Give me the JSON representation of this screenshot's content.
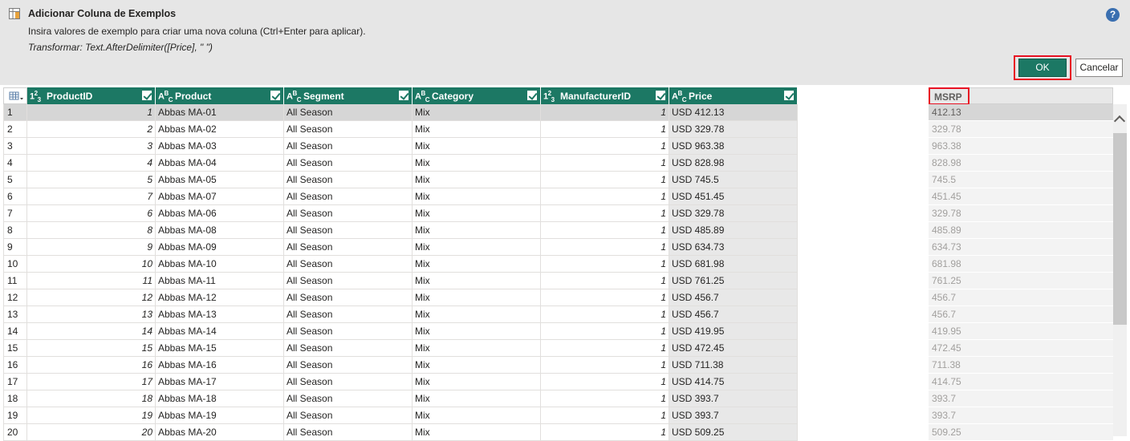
{
  "dialog": {
    "title": "Adicionar Coluna de Exemplos",
    "subtitle": "Insira valores de exemplo para criar uma nova coluna (Ctrl+Enter para aplicar).",
    "transform": "Transformar: Text.AfterDelimiter([Price], \" \")",
    "ok_label": "OK",
    "cancel_label": "Cancelar",
    "help_label": "?"
  },
  "accent_color": "#1c7864",
  "highlight_color": "#e81123",
  "columns": [
    {
      "type": "123",
      "name": "ProductID"
    },
    {
      "type": "ABC",
      "name": "Product"
    },
    {
      "type": "ABC",
      "name": "Segment"
    },
    {
      "type": "ABC",
      "name": "Category"
    },
    {
      "type": "123",
      "name": "ManufacturerID"
    },
    {
      "type": "ABC",
      "name": "Price"
    }
  ],
  "new_column": {
    "name": "MSRP"
  },
  "rows": [
    {
      "n": "1",
      "id": "1",
      "product": "Abbas MA-01",
      "segment": "All Season",
      "category": "Mix",
      "mfr": "1",
      "price": "USD 412.13",
      "msrp": "412.13"
    },
    {
      "n": "2",
      "id": "2",
      "product": "Abbas MA-02",
      "segment": "All Season",
      "category": "Mix",
      "mfr": "1",
      "price": "USD 329.78",
      "msrp": "329.78"
    },
    {
      "n": "3",
      "id": "3",
      "product": "Abbas MA-03",
      "segment": "All Season",
      "category": "Mix",
      "mfr": "1",
      "price": "USD 963.38",
      "msrp": "963.38"
    },
    {
      "n": "4",
      "id": "4",
      "product": "Abbas MA-04",
      "segment": "All Season",
      "category": "Mix",
      "mfr": "1",
      "price": "USD 828.98",
      "msrp": "828.98"
    },
    {
      "n": "5",
      "id": "5",
      "product": "Abbas MA-05",
      "segment": "All Season",
      "category": "Mix",
      "mfr": "1",
      "price": "USD 745.5",
      "msrp": "745.5"
    },
    {
      "n": "6",
      "id": "7",
      "product": "Abbas MA-07",
      "segment": "All Season",
      "category": "Mix",
      "mfr": "1",
      "price": "USD 451.45",
      "msrp": "451.45"
    },
    {
      "n": "7",
      "id": "6",
      "product": "Abbas MA-06",
      "segment": "All Season",
      "category": "Mix",
      "mfr": "1",
      "price": "USD 329.78",
      "msrp": "329.78"
    },
    {
      "n": "8",
      "id": "8",
      "product": "Abbas MA-08",
      "segment": "All Season",
      "category": "Mix",
      "mfr": "1",
      "price": "USD 485.89",
      "msrp": "485.89"
    },
    {
      "n": "9",
      "id": "9",
      "product": "Abbas MA-09",
      "segment": "All Season",
      "category": "Mix",
      "mfr": "1",
      "price": "USD 634.73",
      "msrp": "634.73"
    },
    {
      "n": "10",
      "id": "10",
      "product": "Abbas MA-10",
      "segment": "All Season",
      "category": "Mix",
      "mfr": "1",
      "price": "USD 681.98",
      "msrp": "681.98"
    },
    {
      "n": "11",
      "id": "11",
      "product": "Abbas MA-11",
      "segment": "All Season",
      "category": "Mix",
      "mfr": "1",
      "price": "USD 761.25",
      "msrp": "761.25"
    },
    {
      "n": "12",
      "id": "12",
      "product": "Abbas MA-12",
      "segment": "All Season",
      "category": "Mix",
      "mfr": "1",
      "price": "USD 456.7",
      "msrp": "456.7"
    },
    {
      "n": "13",
      "id": "13",
      "product": "Abbas MA-13",
      "segment": "All Season",
      "category": "Mix",
      "mfr": "1",
      "price": "USD 456.7",
      "msrp": "456.7"
    },
    {
      "n": "14",
      "id": "14",
      "product": "Abbas MA-14",
      "segment": "All Season",
      "category": "Mix",
      "mfr": "1",
      "price": "USD 419.95",
      "msrp": "419.95"
    },
    {
      "n": "15",
      "id": "15",
      "product": "Abbas MA-15",
      "segment": "All Season",
      "category": "Mix",
      "mfr": "1",
      "price": "USD 472.45",
      "msrp": "472.45"
    },
    {
      "n": "16",
      "id": "16",
      "product": "Abbas MA-16",
      "segment": "All Season",
      "category": "Mix",
      "mfr": "1",
      "price": "USD 711.38",
      "msrp": "711.38"
    },
    {
      "n": "17",
      "id": "17",
      "product": "Abbas MA-17",
      "segment": "All Season",
      "category": "Mix",
      "mfr": "1",
      "price": "USD 414.75",
      "msrp": "414.75"
    },
    {
      "n": "18",
      "id": "18",
      "product": "Abbas MA-18",
      "segment": "All Season",
      "category": "Mix",
      "mfr": "1",
      "price": "USD 393.7",
      "msrp": "393.7"
    },
    {
      "n": "19",
      "id": "19",
      "product": "Abbas MA-19",
      "segment": "All Season",
      "category": "Mix",
      "mfr": "1",
      "price": "USD 393.7",
      "msrp": "393.7"
    },
    {
      "n": "20",
      "id": "20",
      "product": "Abbas MA-20",
      "segment": "All Season",
      "category": "Mix",
      "mfr": "1",
      "price": "USD 509.25",
      "msrp": "509.25"
    }
  ]
}
